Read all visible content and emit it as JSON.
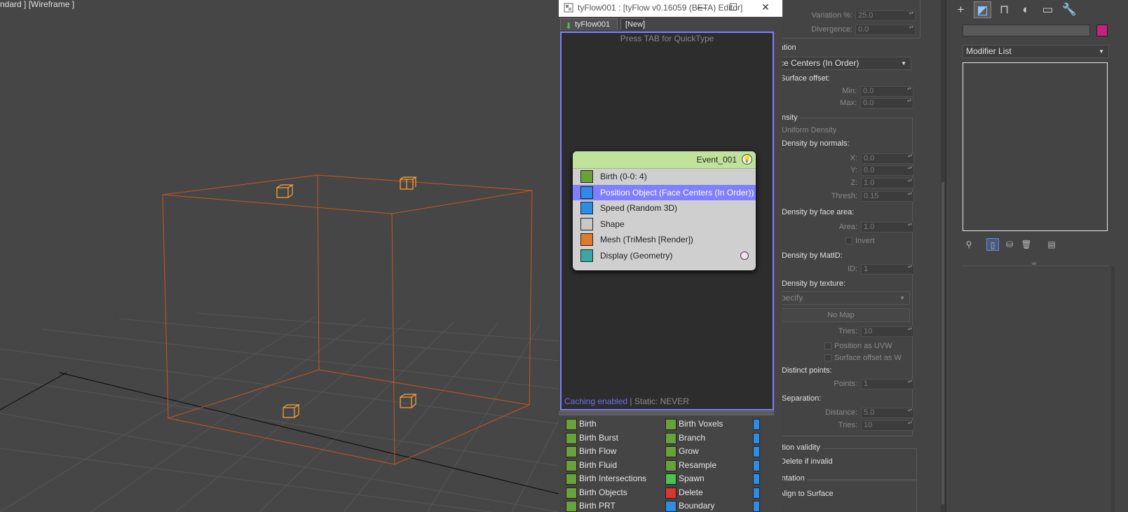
{
  "viewport": {
    "label": "ndard ] [Wireframe ]"
  },
  "editor": {
    "title": "tyFlow001 : [tyFlow v0.16059 (BETA) Editor]",
    "window_controls": {
      "minimize": "—",
      "maximize": "☐",
      "close": "✕"
    },
    "tabs": [
      {
        "label": "tyFlow001"
      },
      {
        "label": "[New]"
      }
    ],
    "canvas_hint": "Press TAB for QuickType",
    "status": {
      "caching": "Caching enabled",
      "separator": "|",
      "static": "Static: NEVER"
    },
    "event": {
      "name": "Event_001",
      "bulb_icon": "light-bulb-icon",
      "operators": [
        {
          "label": "Birth (0-0: 4)",
          "icon": "birth-icon",
          "color": "#6aa23a"
        },
        {
          "label": "Position Object (Face Centers (In Order))",
          "icon": "position-object-icon",
          "color": "#2e8ce6",
          "selected": true
        },
        {
          "label": "Speed (Random 3D)",
          "icon": "speed-icon",
          "color": "#2e8ce6"
        },
        {
          "label": "Shape",
          "icon": "shape-icon",
          "color": "#c8c8c8"
        },
        {
          "label": "Mesh (TriMesh [Render])",
          "icon": "mesh-icon",
          "color": "#e07a2a"
        },
        {
          "label": "Display (Geometry)",
          "icon": "display-icon",
          "color": "#3aa6a6"
        }
      ]
    },
    "palette_col1": [
      {
        "label": "Birth"
      },
      {
        "label": "Birth Burst"
      },
      {
        "label": "Birth Flow"
      },
      {
        "label": "Birth Fluid"
      },
      {
        "label": "Birth Intersections"
      },
      {
        "label": "Birth Objects"
      },
      {
        "label": "Birth PRT"
      }
    ],
    "palette_col2": [
      {
        "label": "Birth Voxels",
        "color": "#6aa23a"
      },
      {
        "label": "Branch",
        "color": "#6aa23a"
      },
      {
        "label": "Grow",
        "color": "#6aa23a"
      },
      {
        "label": "Resample",
        "color": "#6aa23a"
      },
      {
        "label": "Spawn",
        "color": "#4ec24e"
      },
      {
        "label": "Delete",
        "color": "#d8362e"
      },
      {
        "label": "Boundary",
        "color": "#2e8ce6"
      }
    ]
  },
  "params": {
    "top_partial": {
      "variation_label": "Variation %:",
      "variation_value": "25.0",
      "divergence_label": "Divergence:",
      "divergence_value": "0.0"
    },
    "location": {
      "title": "Location",
      "mode": "Face Centers (In Order)",
      "surface_offset": "Surface offset:",
      "min_label": "Min:",
      "min_value": "0.0",
      "max_label": "Max:",
      "max_value": "0.0"
    },
    "density": {
      "title": "Density",
      "uniform": "Uniform Density",
      "by_normals": "Density by normals:",
      "x_label": "X:",
      "x_value": "0.0",
      "y_label": "Y:",
      "y_value": "0.0",
      "z_label": "Z:",
      "z_value": "1.0",
      "thresh_label": "Thresh:",
      "thresh_value": "0.15",
      "by_face_area": "Density by face area:",
      "area_label": "Area:",
      "area_value": "1.0",
      "invert": "Invert",
      "by_matid": "Density by MatID:",
      "id_label": "ID:",
      "id_value": "1",
      "by_texture": "Density by texture:",
      "specify": "Specify",
      "no_map": "No Map",
      "tries_label": "Tries:",
      "tries_value": "10",
      "pos_as_uvw": "Position as UVW",
      "surf_offset_w": "Surface offset as W",
      "distinct": "Distinct points:",
      "points_label": "Points:",
      "points_value": "1",
      "separation": "Separation:",
      "distance_label": "Distance:",
      "distance_value": "5.0",
      "sep_tries_label": "Tries:",
      "sep_tries_value": "10"
    },
    "position_validity": {
      "title": "Position validity",
      "delete_if_invalid": "Delete if invalid"
    },
    "orientation": {
      "title": "Orientation",
      "align_to_surface": "Align to Surface"
    }
  },
  "cmdpanel": {
    "tabs": [
      {
        "icon": "create-plus-icon",
        "glyph": "+"
      },
      {
        "icon": "modify-icon",
        "glyph": "◩"
      },
      {
        "icon": "hierarchy-icon",
        "glyph": "⊓"
      },
      {
        "icon": "motion-icon",
        "glyph": "◐"
      },
      {
        "icon": "display-monitor-icon",
        "glyph": "▭"
      },
      {
        "icon": "utilities-wrench-icon",
        "glyph": "🔧"
      }
    ],
    "object_color": "#c3227f",
    "modifier_list": "Modifier List",
    "stack_tools": [
      {
        "icon": "pin-stack-icon",
        "glyph": "⚲"
      },
      {
        "icon": "show-end-result-icon",
        "glyph": "▯"
      },
      {
        "icon": "make-unique-icon",
        "glyph": "⛁"
      },
      {
        "icon": "remove-modifier-icon",
        "glyph": "🗑"
      },
      {
        "icon": "configure-sets-icon",
        "glyph": "▤"
      }
    ]
  }
}
